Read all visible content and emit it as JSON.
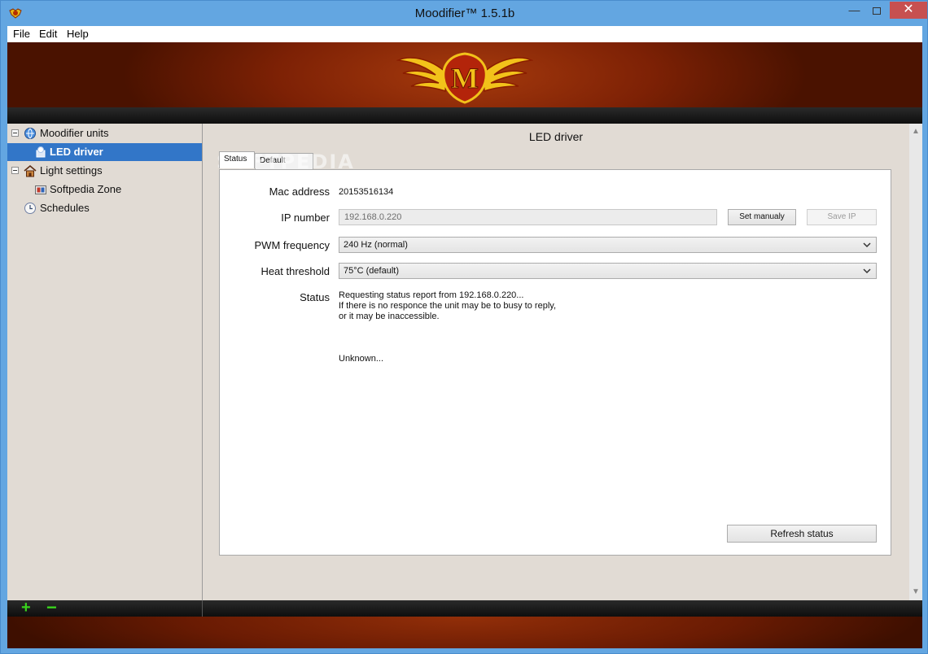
{
  "window": {
    "title": "Moodifier™ 1.5.1b",
    "controls": {
      "minimize": "—",
      "close": "✕"
    }
  },
  "menu": {
    "file": "File",
    "edit": "Edit",
    "help": "Help"
  },
  "banner": {
    "logo_letter": "M"
  },
  "sidebar": {
    "items": [
      {
        "label": "Moodifier units",
        "icon": "globe-icon"
      },
      {
        "label": "LED driver",
        "icon": "led-driver-icon",
        "selected": true
      },
      {
        "label": "Light settings",
        "icon": "home-icon"
      },
      {
        "label": "Softpedia Zone",
        "icon": "zone-icon"
      },
      {
        "label": "Schedules",
        "icon": "clock-icon"
      }
    ]
  },
  "panel": {
    "title": "LED driver",
    "watermark": "SOFTPEDIA",
    "tabs": [
      {
        "label": "Status",
        "active": true
      },
      {
        "label": "Default setting"
      }
    ],
    "fields": {
      "mac": {
        "label": "Mac address",
        "value": "20153516134"
      },
      "ip": {
        "label": "IP number",
        "value": "192.168.0.220",
        "set_button": "Set manualy",
        "save_button": "Save IP"
      },
      "pwm": {
        "label": "PWM frequency",
        "value": "240 Hz (normal)"
      },
      "heat": {
        "label": "Heat threshold",
        "value": "75°C (default)"
      },
      "status": {
        "label": "Status",
        "line1": "Requesting status report from 192.168.0.220...",
        "line2": "If there is no responce the unit may be to busy to reply,",
        "line3": "or it may be inaccessible.",
        "result": "Unknown..."
      }
    },
    "refresh_button": "Refresh status"
  },
  "bottom": {
    "add_label": "+",
    "remove_label": "−"
  },
  "colors": {
    "accent": "#3276c8",
    "banner": "#7d2105",
    "add_green": "#39d21d"
  }
}
